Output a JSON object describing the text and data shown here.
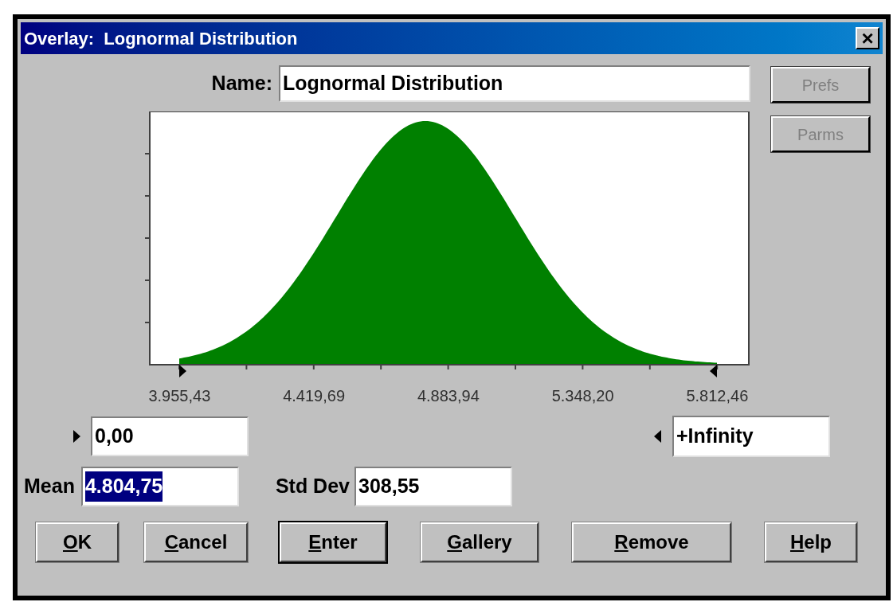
{
  "window": {
    "title": "Overlay:  Lognormal Distribution",
    "close": "×"
  },
  "name_field": {
    "label": "Name:",
    "value": "Lognormal Distribution"
  },
  "side_buttons": [
    {
      "label": "Prefs",
      "disabled": true
    },
    {
      "label": "Parms",
      "disabled": true
    }
  ],
  "axis_labels": [
    "3.955,43",
    "4.419,69",
    "4.883,94",
    "5.348,20",
    "5.812,46"
  ],
  "bounds": {
    "left": {
      "value": "0,00",
      "selected": false
    },
    "right": {
      "value": "+Infinity",
      "selected": false
    }
  },
  "params": [
    {
      "label": "Mean",
      "value": "4.804,75",
      "selected": true
    },
    {
      "label": "Std Dev",
      "value": "308,55",
      "selected": false
    }
  ],
  "buttons": [
    {
      "key": "O",
      "rest": "K",
      "default": false
    },
    {
      "key": "C",
      "rest": "ancel",
      "default": false
    },
    {
      "key": "E",
      "rest": "nter",
      "default": true
    },
    {
      "key": "G",
      "rest": "allery",
      "default": false
    },
    {
      "key": "R",
      "rest": "emove",
      "default": false
    },
    {
      "key": "H",
      "rest": "elp",
      "default": false
    }
  ]
}
